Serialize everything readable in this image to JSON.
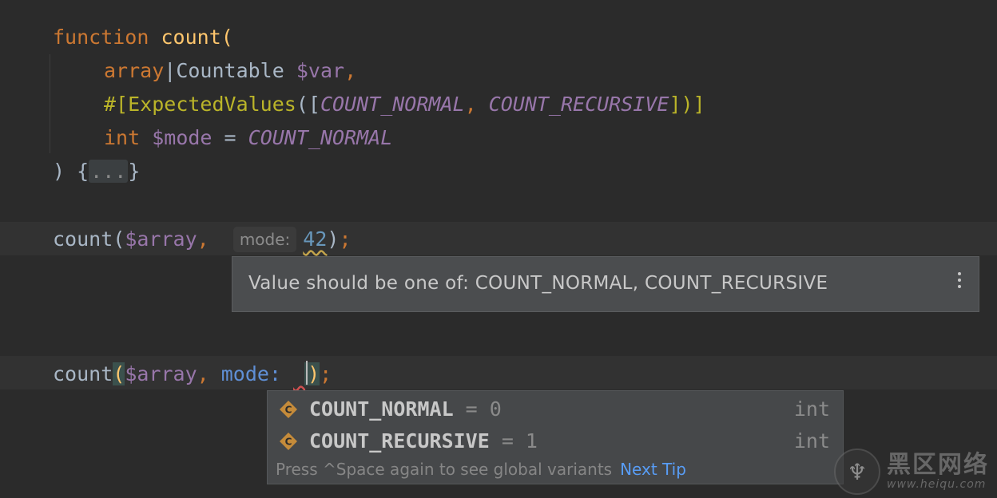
{
  "code": {
    "line1": {
      "kw": "function",
      "fn": "count",
      "open": "("
    },
    "line2": {
      "t1": "array",
      "bar": "|",
      "t2": "Countable",
      "var": "$var",
      "comma": ","
    },
    "line3": {
      "attr_open": "#[",
      "attr_name": "ExpectedValues",
      "p1": "([",
      "c1": "COUNT_NORMAL",
      "sep": ", ",
      "c2": "COUNT_RECURSIVE",
      "p2": "])]"
    },
    "line4": {
      "kw": "int",
      "var": "$mode",
      "eq": " = ",
      "cst": "COUNT_NORMAL"
    },
    "line5": {
      "close": ") {",
      "fold": "...",
      "brace": "}"
    },
    "call1": {
      "fn": "count",
      "open": "(",
      "var": "$array",
      "comma": ", ",
      "hint": "mode:",
      "num": "42",
      "close": ")",
      "semi": ";"
    },
    "call2": {
      "fn": "count",
      "open": "(",
      "var": "$array",
      "comma": ", ",
      "named": "mode: ",
      "close": ")",
      "semi": ";"
    }
  },
  "tooltip": {
    "message": "Value should be one of: COUNT_NORMAL, COUNT_RECURSIVE"
  },
  "completion": {
    "items": [
      {
        "name": "COUNT_NORMAL",
        "value": " = 0",
        "type": "int",
        "icon": "constant-icon"
      },
      {
        "name": "COUNT_RECURSIVE",
        "value": " = 1",
        "type": "int",
        "icon": "constant-icon"
      }
    ],
    "footer": "Press ^Space again to see global variants",
    "tip_link": "Next Tip"
  },
  "watermark": {
    "big": "黑区网络",
    "small": "www.heiqu.com"
  },
  "colors": {
    "keyword": "#cc7832",
    "function": "#ffc66d",
    "variable": "#9876aa",
    "attribute": "#bbb529",
    "link": "#589df6"
  }
}
